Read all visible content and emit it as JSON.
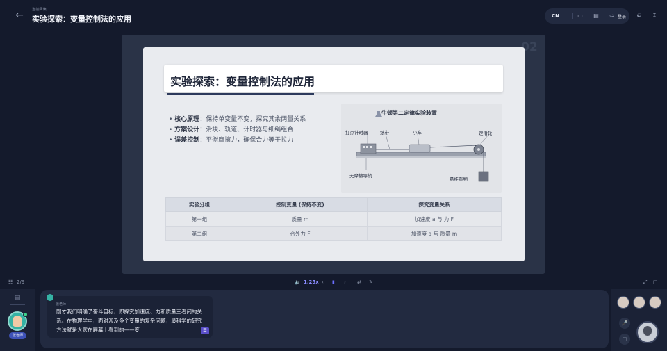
{
  "header": {
    "breadcrumb": "当前阅读",
    "title": "实验探索：变量控制法的应用",
    "lang": "CN",
    "login_label": "登录"
  },
  "slide": {
    "page_number": "02",
    "title": "实验探索：变量控制法的应用",
    "bullets": [
      {
        "label": "核心原理",
        "text": "：保持单变量不变，探究其余两量关系"
      },
      {
        "label": "方案设计",
        "text": "：滑块、轨道、计时器与细绳组合"
      },
      {
        "label": "误差控制",
        "text": "：平衡摩擦力，确保合力等于拉力"
      }
    ],
    "diagram": {
      "title": "牛顿第二定律实验装置",
      "labels": {
        "timer": "打点计时器",
        "tape": "纸带",
        "cart": "小车",
        "pulley": "定滑轮",
        "track": "无摩擦导轨",
        "weight": "悬挂重物"
      }
    },
    "table": {
      "headers": [
        "实验分组",
        "控制变量 (保持不变)",
        "探究变量关系"
      ],
      "rows": [
        [
          "第一组",
          "质量 m",
          "加速度 a 与 力 F"
        ],
        [
          "第二组",
          "合外力 F",
          "加速度 a 与 质量 m"
        ]
      ]
    }
  },
  "controls": {
    "page_indicator": "2/9",
    "speed": "1.25x"
  },
  "sidebar": {
    "teacher_tag": "张老师"
  },
  "chat": {
    "speaker": "张老师",
    "message": "刚才我们明确了奋斗目标，即探究加速度、力和质量三者间的关系。在物理学中，面对涉及多个变量的复杂问题，最科学的研究方法就是大家在屏幕上看到的——变"
  },
  "colors": {
    "background": "#141a2c",
    "panel": "#222a40",
    "accent": "#6c6fff",
    "slide_bg": "#e9ebef"
  }
}
